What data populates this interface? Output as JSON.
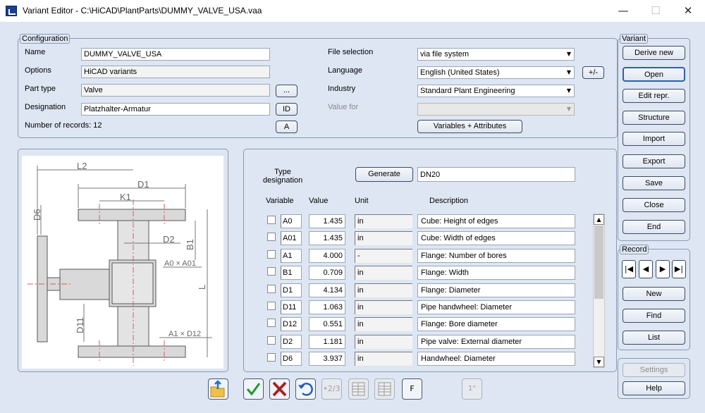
{
  "window": {
    "title": "Variant Editor - C:\\HiCAD\\PlantParts\\DUMMY_VALVE_USA.vaa",
    "minimize": "—",
    "maximize": "☐",
    "close": "✕"
  },
  "configuration": {
    "group_label": "Configuration",
    "name_label": "Name",
    "name_value": "DUMMY_VALVE_USA",
    "options_label": "Options",
    "options_value": "HiCAD variants",
    "part_type_label": "Part type",
    "part_type_value": "Valve",
    "part_type_button": "...",
    "designation_label": "Designation",
    "designation_value": "Platzhalter-Armatur",
    "designation_button": "ID",
    "records_label": "Number of records: 12",
    "records_button": "A",
    "file_selection_label": "File selection",
    "file_selection_value": "via file system",
    "language_label": "Language",
    "language_value": "English (United States)",
    "language_button": "+/-",
    "industry_label": "Industry",
    "industry_value": "Standard Plant Engineering",
    "value_for_label": "Value for",
    "value_for_value": "",
    "variables_button": "Variables + Attributes"
  },
  "drawing_labels": {
    "L2": "L2",
    "D1": "D1",
    "K1": "K1",
    "D6": "D6",
    "D2": "D2",
    "B1": "B1",
    "A0xA01": "A0 × A01",
    "L": "L",
    "D11": "D11",
    "A1xD12": "A1 × D12"
  },
  "variables": {
    "type_designation_label": "Type designation",
    "generate_button": "Generate",
    "type_designation_value": "DN20",
    "col_variable": "Variable",
    "col_value": "Value",
    "col_unit": "Unit",
    "col_description": "Description",
    "rows": [
      {
        "name": "A0",
        "value": "1.435",
        "unit": "in",
        "description": "Cube: Height of edges"
      },
      {
        "name": "A01",
        "value": "1.435",
        "unit": "in",
        "description": "Cube: Width of edges"
      },
      {
        "name": "A1",
        "value": "4.000",
        "unit": "-",
        "description": "Flange: Number of bores"
      },
      {
        "name": "B1",
        "value": "0.709",
        "unit": "in",
        "description": "Flange: Width"
      },
      {
        "name": "D1",
        "value": "4.134",
        "unit": "in",
        "description": "Flange: Diameter"
      },
      {
        "name": "D11",
        "value": "1.063",
        "unit": "in",
        "description": "Pipe handwheel: Diameter"
      },
      {
        "name": "D12",
        "value": "0.551",
        "unit": "in",
        "description": "Flange: Bore diameter"
      },
      {
        "name": "D2",
        "value": "1.181",
        "unit": "in",
        "description": "Pipe valve: External diameter"
      },
      {
        "name": "D6",
        "value": "3.937",
        "unit": "in",
        "description": "Handwheel: Diameter"
      }
    ]
  },
  "toolbar": {
    "undo_steps": "•2/3",
    "f_label": "F",
    "one_label": "1\""
  },
  "variant_panel": {
    "group_label": "Variant",
    "derive_new": "Derive new",
    "open": "Open",
    "edit_repr": "Edit repr.",
    "structure": "Structure",
    "import": "Import",
    "export": "Export",
    "save": "Save",
    "close": "Close",
    "end": "End"
  },
  "record_panel": {
    "group_label": "Record",
    "first": "|◀",
    "prev": "◀",
    "next": "▶",
    "last": "▶|",
    "new": "New",
    "find": "Find",
    "list": "List"
  },
  "bottom_panel": {
    "settings": "Settings",
    "help": "Help"
  }
}
